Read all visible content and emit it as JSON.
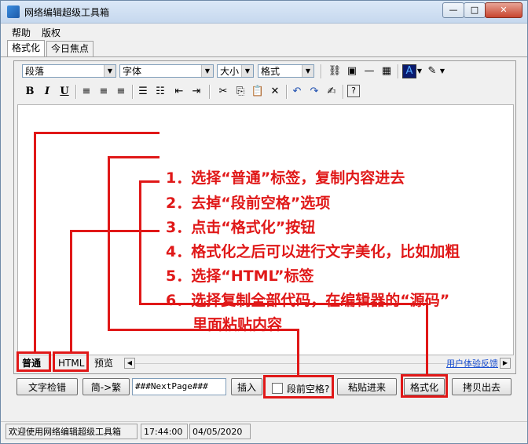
{
  "window": {
    "title": "网络编辑超级工具箱",
    "min": "—",
    "max": "□",
    "close": "✕"
  },
  "menu": [
    "帮助",
    "版权"
  ],
  "tabs": [
    "格式化",
    "今日焦点"
  ],
  "toolbar": {
    "paragraph": "段落",
    "font": "字体",
    "size": "大小",
    "format": "格式",
    "bold": "B",
    "italic": "I",
    "underline": "U"
  },
  "steps": [
    "1．选择“普通”标签，复制内容进去",
    "2．去掉“段前空格”选项",
    "3．点击“格式化”按钮",
    "4．格式化之后可以进行文字美化，比如加粗",
    "5．选择“HTML”标签",
    "6．选择复制全部代码，在编辑器的“源码”",
    "里面粘贴内容"
  ],
  "editor_tabs": {
    "normal": "普通",
    "html": "HTML",
    "preview": "预览",
    "feedback": "用户体验反馈"
  },
  "buttons": {
    "spellcheck": "文字检错",
    "convert": "简->繁",
    "nextpage": "###NextPage###",
    "insert": "插入",
    "indent_label": "段前空格?",
    "paste": "粘贴进来",
    "format": "格式化",
    "copy": "拷贝出去"
  },
  "status": {
    "message": "欢迎使用网络编辑超级工具箱",
    "time": "17:44:00",
    "date": "04/05/2020"
  },
  "colors": {
    "annotation": "#e01818",
    "link": "#1a4fd0"
  }
}
